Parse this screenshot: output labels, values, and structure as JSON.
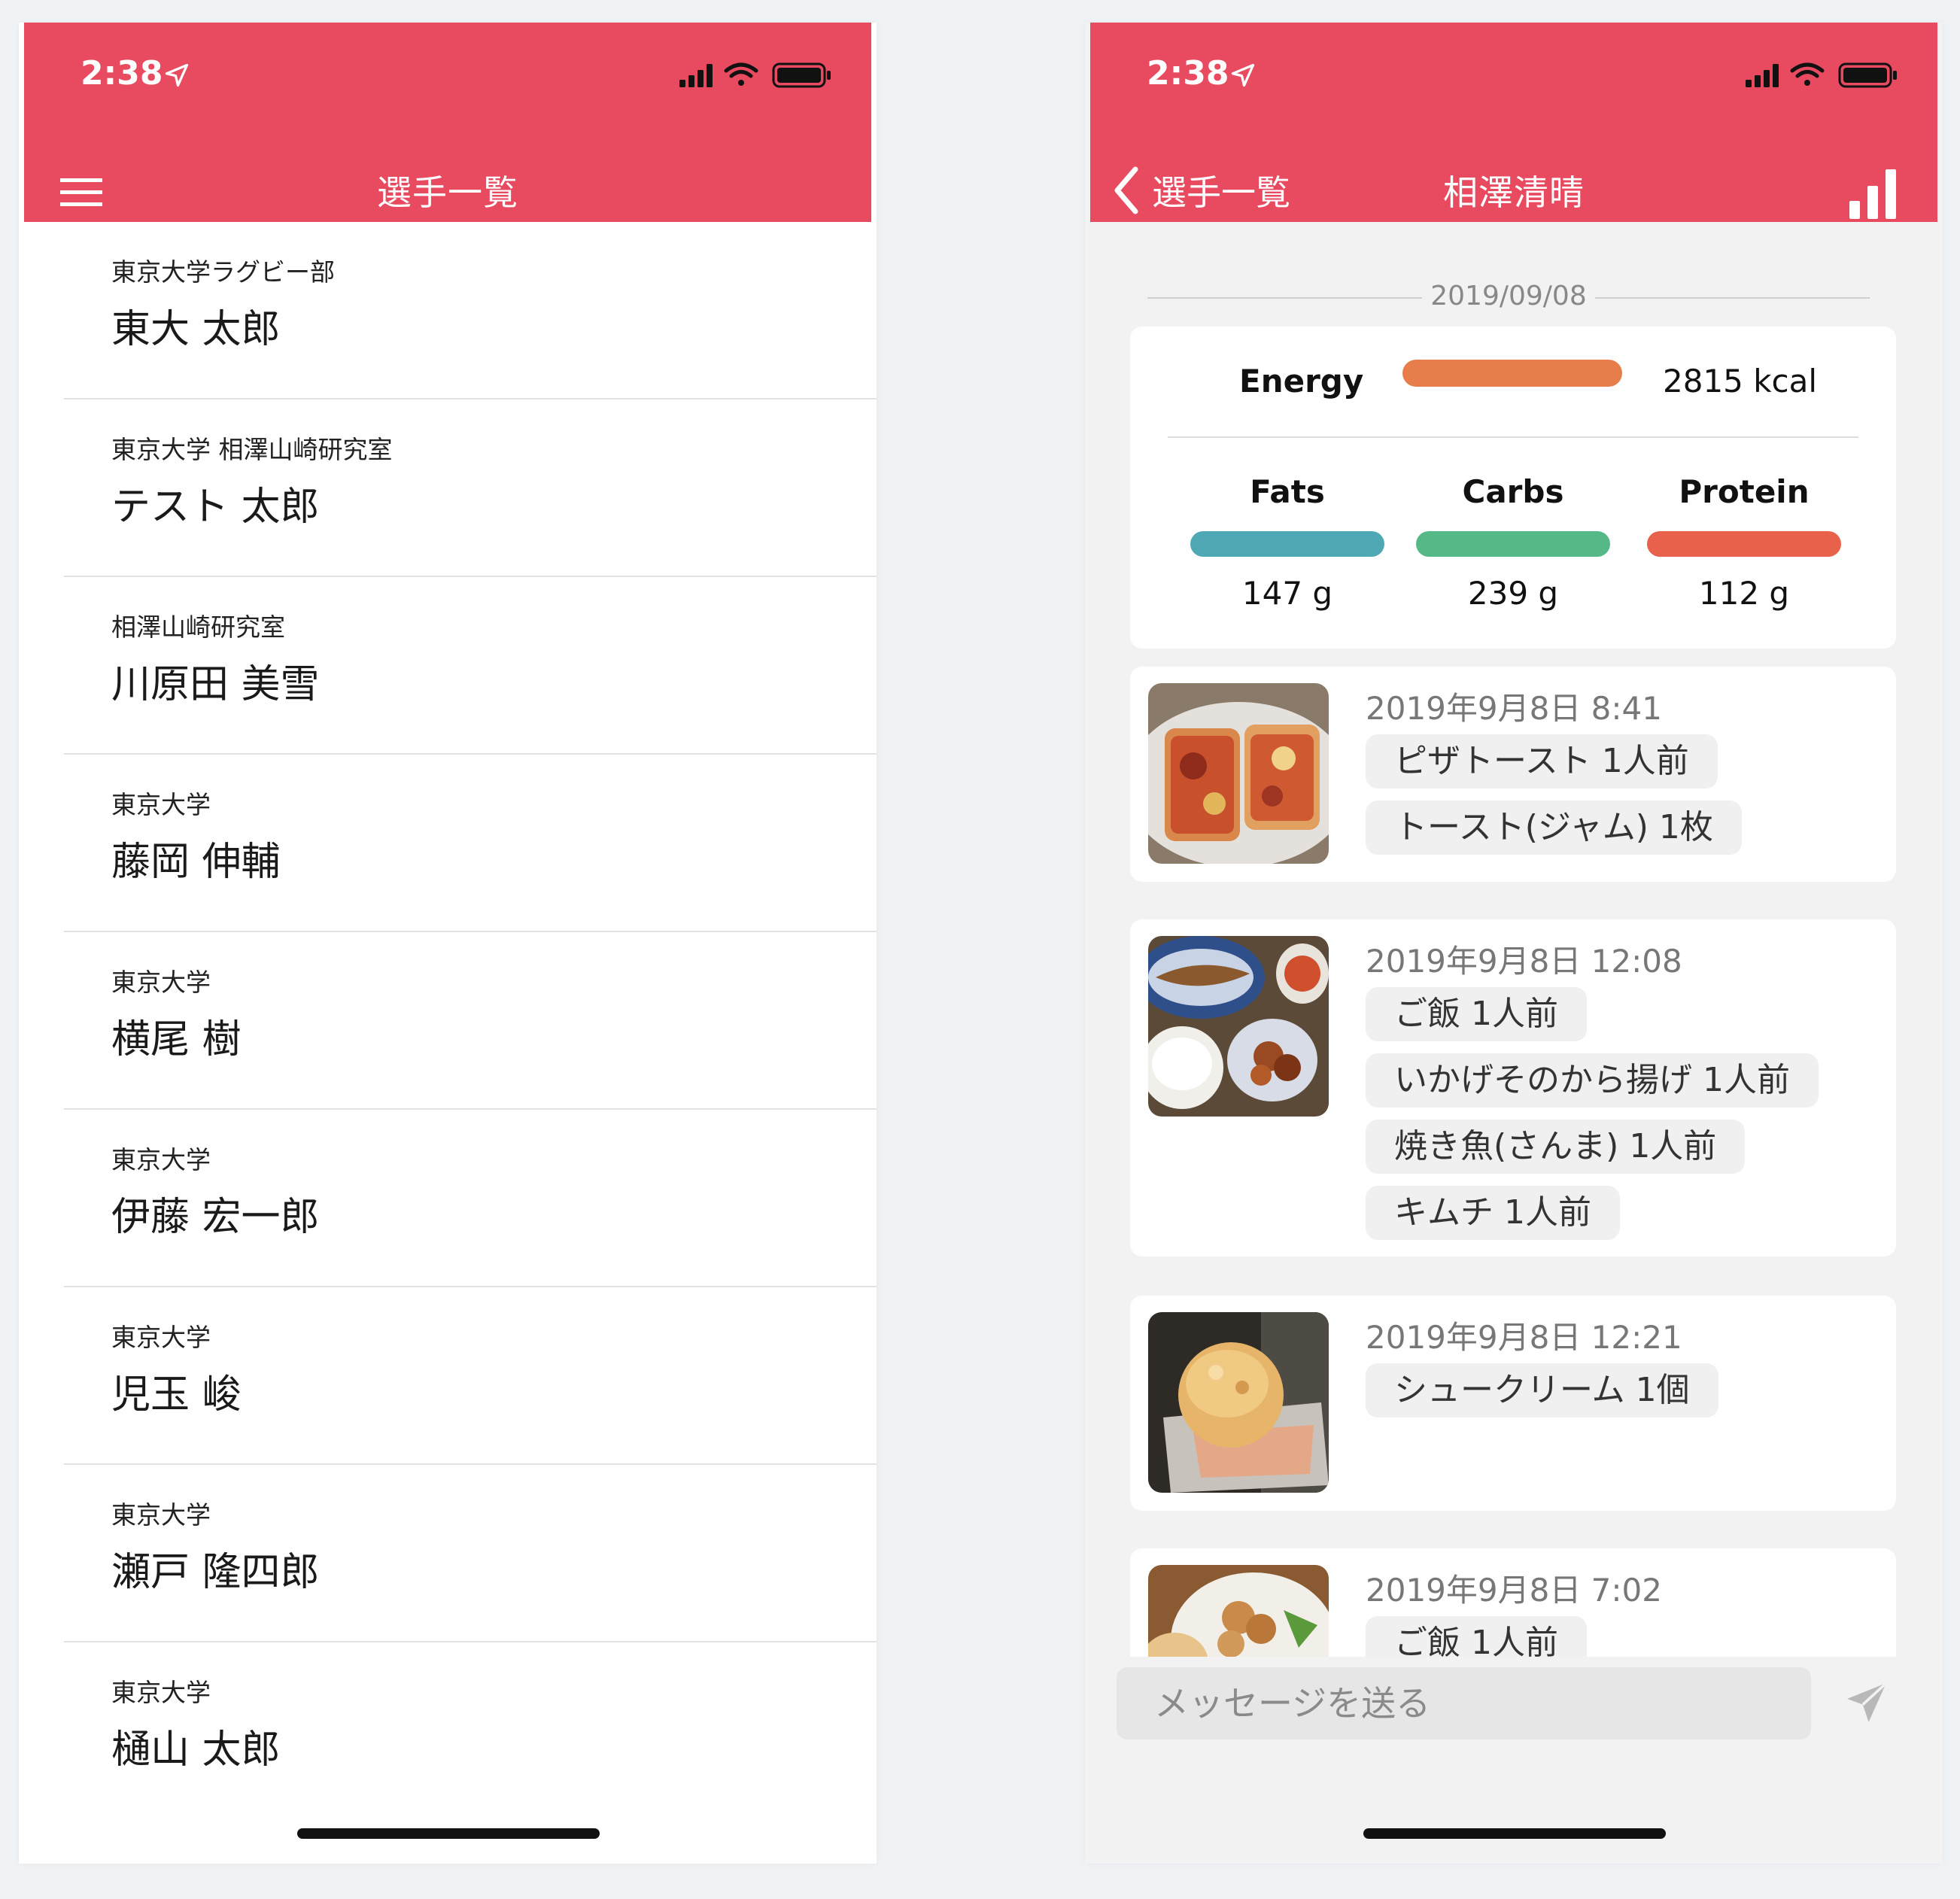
{
  "status_bar": {
    "time": "2:38"
  },
  "left": {
    "nav_title": "選手一覧",
    "athletes": [
      {
        "org": "東京大学ラグビー部",
        "name": "東大 太郎"
      },
      {
        "org": "東京大学 相澤山崎研究室",
        "name": "テスト 太郎"
      },
      {
        "org": "相澤山崎研究室",
        "name": "川原田 美雪"
      },
      {
        "org": "東京大学",
        "name": "藤岡 伸輔"
      },
      {
        "org": "東京大学",
        "name": "横尾 樹"
      },
      {
        "org": "東京大学",
        "name": "伊藤 宏一郎"
      },
      {
        "org": "東京大学",
        "name": "児玉 峻"
      },
      {
        "org": "東京大学",
        "name": "瀬戸 隆四郎"
      },
      {
        "org": "東京大学",
        "name": "樋山 太郎"
      }
    ]
  },
  "right": {
    "back_label": "選手一覧",
    "nav_title": "相澤清晴",
    "date": "2019/09/08",
    "energy": {
      "label": "Energy",
      "value": "2815 kcal",
      "color": "#e87d4c"
    },
    "macros": [
      {
        "label": "Fats",
        "value": "147 g",
        "color": "#4fa9b4"
      },
      {
        "label": "Carbs",
        "value": "239 g",
        "color": "#55b887"
      },
      {
        "label": "Protein",
        "value": "112 g",
        "color": "#e8614a"
      }
    ],
    "meals": [
      {
        "time": "2019年9月8日 8:41",
        "items": [
          "ピザトースト 1人前",
          "トースト(ジャム) 1枚"
        ]
      },
      {
        "time": "2019年9月8日 12:08",
        "items": [
          "ご飯 1人前",
          "いかげそのから揚げ 1人前",
          "焼き魚(さんま) 1人前",
          "キムチ 1人前"
        ]
      },
      {
        "time": "2019年9月8日 12:21",
        "items": [
          "シュークリーム 1個"
        ]
      },
      {
        "time": "2019年9月8日 7:02",
        "items": [
          "ご飯 1人前"
        ]
      }
    ],
    "message_placeholder": "メッセージを送る"
  },
  "colors": {
    "header": "#e84a60"
  },
  "icons": [
    "menu-icon",
    "location-arrow-icon",
    "signal-icon",
    "wifi-icon",
    "battery-icon",
    "back-chevron-icon",
    "bar-chart-icon",
    "send-icon"
  ]
}
